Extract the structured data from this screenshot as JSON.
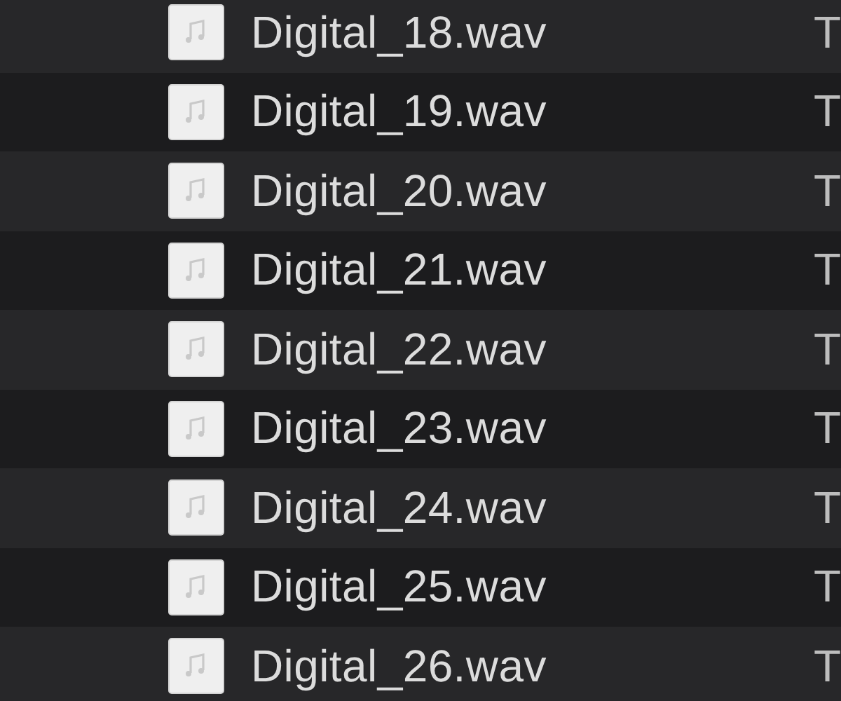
{
  "files": [
    {
      "name": "Digital_18.wav",
      "column_2": "T"
    },
    {
      "name": "Digital_19.wav",
      "column_2": "T"
    },
    {
      "name": "Digital_20.wav",
      "column_2": "T"
    },
    {
      "name": "Digital_21.wav",
      "column_2": "T"
    },
    {
      "name": "Digital_22.wav",
      "column_2": "T"
    },
    {
      "name": "Digital_23.wav",
      "column_2": "T"
    },
    {
      "name": "Digital_24.wav",
      "column_2": "T"
    },
    {
      "name": "Digital_25.wav",
      "column_2": "T"
    },
    {
      "name": "Digital_26.wav",
      "column_2": "T"
    }
  ]
}
